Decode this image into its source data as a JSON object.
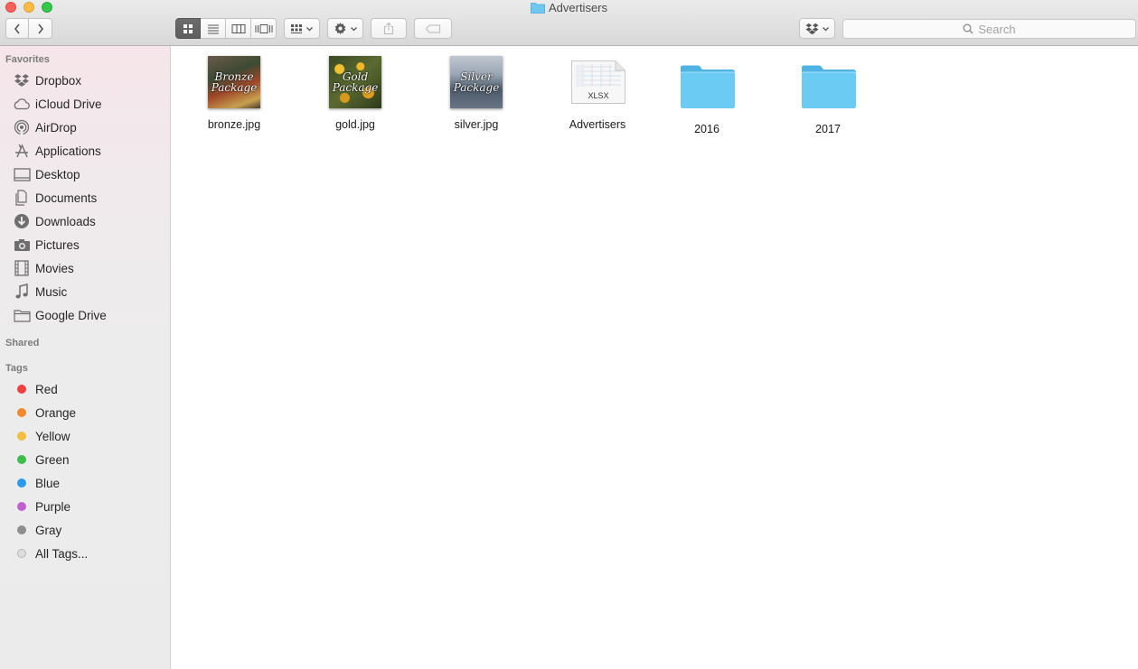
{
  "window": {
    "title": "Advertisers"
  },
  "toolbar": {
    "back_icon": "chevron-left-icon",
    "forward_icon": "chevron-right-icon",
    "view_modes": [
      "icon-view-icon",
      "list-view-icon",
      "column-view-icon",
      "cover-flow-icon"
    ],
    "active_view": "icon-view-icon",
    "arrange_icon": "arrange-grid-icon",
    "action_icon": "gear-icon",
    "share_icon": "share-icon",
    "tag_icon": "tag-icon",
    "dropbox_icon": "dropbox-icon",
    "search_placeholder": "Search"
  },
  "sidebar": {
    "favorites_header": "Favorites",
    "favorites": [
      {
        "label": "Dropbox",
        "icon": "dropbox-icon"
      },
      {
        "label": "iCloud Drive",
        "icon": "cloud-icon"
      },
      {
        "label": "AirDrop",
        "icon": "airdrop-icon"
      },
      {
        "label": "Applications",
        "icon": "applications-icon"
      },
      {
        "label": "Desktop",
        "icon": "desktop-icon"
      },
      {
        "label": "Documents",
        "icon": "documents-icon"
      },
      {
        "label": "Downloads",
        "icon": "download-icon"
      },
      {
        "label": "Pictures",
        "icon": "camera-icon"
      },
      {
        "label": "Movies",
        "icon": "film-icon"
      },
      {
        "label": "Music",
        "icon": "music-note-icon"
      },
      {
        "label": "Google Drive",
        "icon": "folder-icon"
      }
    ],
    "shared_header": "Shared",
    "tags_header": "Tags",
    "tags": [
      {
        "label": "Red",
        "color": "#ee4040"
      },
      {
        "label": "Orange",
        "color": "#f0892d"
      },
      {
        "label": "Yellow",
        "color": "#f2bf3c"
      },
      {
        "label": "Green",
        "color": "#3ebd4a"
      },
      {
        "label": "Blue",
        "color": "#2d9ae9"
      },
      {
        "label": "Purple",
        "color": "#c061d1"
      },
      {
        "label": "Gray",
        "color": "#8e8e8e"
      },
      {
        "label": "All Tags...",
        "color": "#d8d8d8"
      }
    ]
  },
  "files": [
    {
      "name": "bronze.jpg",
      "kind": "image",
      "caption_lines": [
        "Bronze",
        "Package"
      ],
      "colors": [
        "#6c5a4a",
        "#3c4a34",
        "#a04828",
        "#c8a050"
      ]
    },
    {
      "name": "gold.jpg",
      "kind": "image",
      "caption_lines": [
        "Gold",
        "Package"
      ],
      "colors": [
        "#3a4a24",
        "#d89a1c",
        "#5a6a30",
        "#f0c030"
      ]
    },
    {
      "name": "silver.jpg",
      "kind": "image",
      "caption_lines": [
        "Silver",
        "Package"
      ],
      "colors": [
        "#9aa6b4",
        "#4c5a6a",
        "#c0c8d0",
        "#6a7484"
      ]
    },
    {
      "name": "Advertisers",
      "kind": "spreadsheet",
      "badge": "XLSX"
    },
    {
      "name": "2016",
      "kind": "folder"
    },
    {
      "name": "2017",
      "kind": "folder"
    }
  ],
  "colors": {
    "folder_blue": "#5ec4f0",
    "active_segment": "#626262"
  }
}
